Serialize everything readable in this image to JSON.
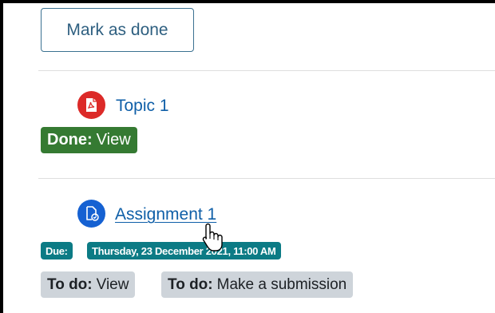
{
  "mark_as_done_label": "Mark as done",
  "activities": [
    {
      "title": "Topic 1",
      "icon": "pdf-icon",
      "completion": {
        "prefix": "Done:",
        "text": "View"
      }
    },
    {
      "title": "Assignment 1",
      "icon": "assignment-icon",
      "due_label": "Due:",
      "due_date": "Thursday, 23 December 2021, 11:00 AM",
      "requirements": [
        {
          "prefix": "To do:",
          "text": "View"
        },
        {
          "prefix": "To do:",
          "text": "Make a submission"
        }
      ]
    }
  ],
  "colors": {
    "pdf_icon": "#dc2a28",
    "assignment_icon": "#1561d2",
    "done_badge": "#357a32",
    "due_badge": "#0c7b85",
    "todo_badge": "#ced4da",
    "link": "#0f5fa8"
  }
}
